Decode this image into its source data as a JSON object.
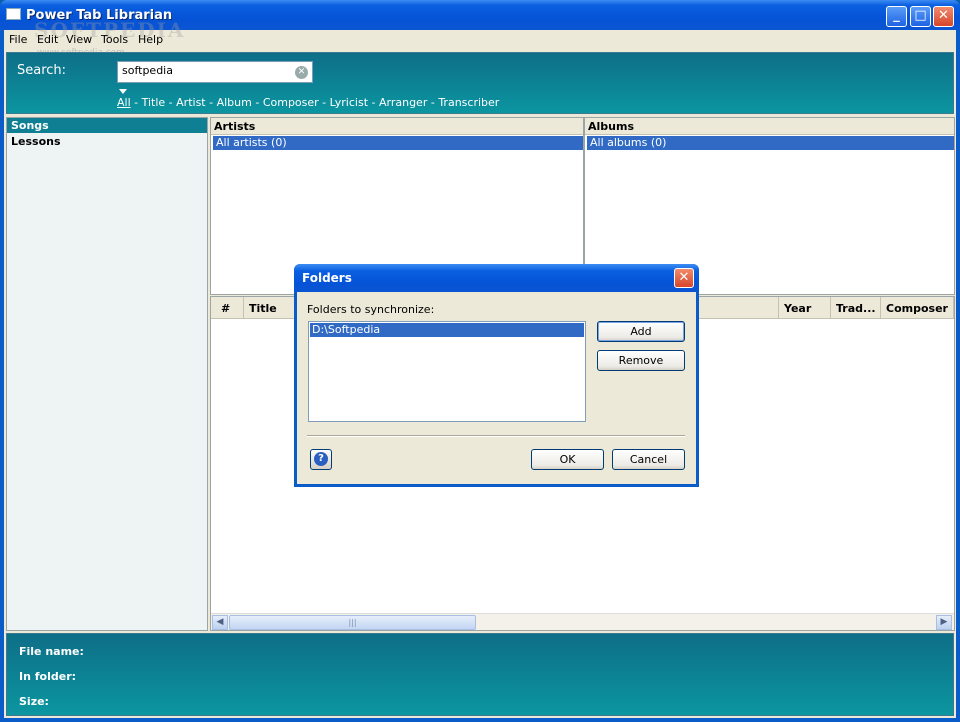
{
  "window": {
    "title": "Power Tab Librarian"
  },
  "titlebar_buttons": {
    "minimize": "_",
    "maximize": "□",
    "close": "✕"
  },
  "menu": [
    "File",
    "Edit",
    "View",
    "Tools",
    "Help"
  ],
  "watermark": {
    "text": "SOFTPEDIA",
    "url": "www.softpedia.com"
  },
  "search": {
    "label": "Search:",
    "value": "softpedia",
    "filters": [
      "All",
      "Title",
      "Artist",
      "Album",
      "Composer",
      "Lyricist",
      "Arranger",
      "Transcriber"
    ],
    "separator": " - ",
    "selected_filter": "All"
  },
  "sidebar": {
    "items": [
      "Songs",
      "Lessons"
    ],
    "active": "Songs"
  },
  "artists": {
    "header": "Artists",
    "rows": [
      "All artists (0)"
    ]
  },
  "albums": {
    "header": "Albums",
    "rows": [
      "All albums (0)"
    ]
  },
  "songlist": {
    "columns": [
      "#",
      "Title",
      "Year",
      "Trad...",
      "Composer"
    ]
  },
  "info": {
    "file_name_label": "File name:",
    "in_folder_label": "In folder:",
    "size_label": "Size:"
  },
  "dialog": {
    "title": "Folders",
    "label": "Folders to synchronize:",
    "folders": [
      "D:\\Softpedia"
    ],
    "add_label": "Add",
    "remove_label": "Remove",
    "ok_label": "OK",
    "cancel_label": "Cancel",
    "help_glyph": "?",
    "close_glyph": "✕"
  },
  "colors": {
    "band": "#0b96a0",
    "selection": "#316ac5",
    "titlebar": "#0553d6"
  }
}
